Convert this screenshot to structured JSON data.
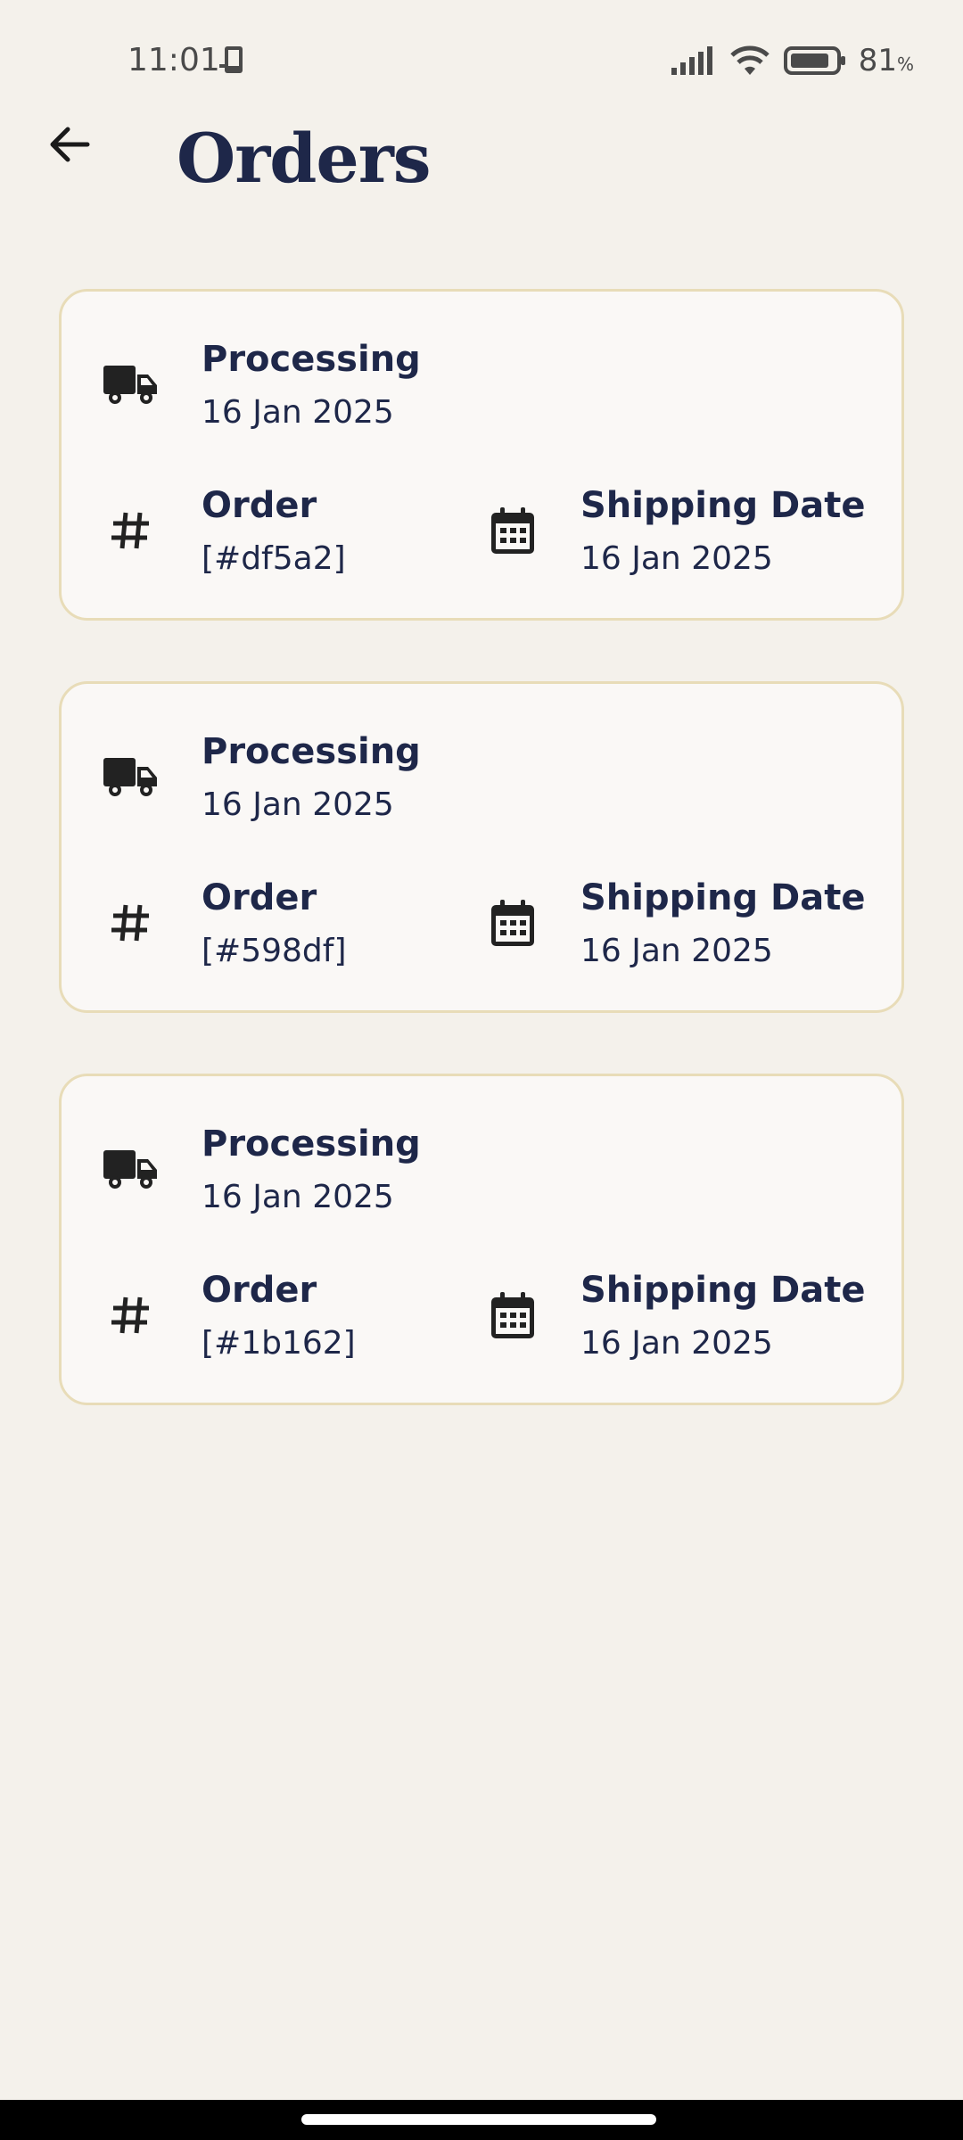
{
  "status_bar": {
    "time": "11:01",
    "battery_percent": "81",
    "battery_unit": "%",
    "icons": [
      "device-icon",
      "signal-icon",
      "wifi-icon",
      "battery-icon"
    ]
  },
  "header": {
    "title": "Orders",
    "back_icon": "arrow-left-icon"
  },
  "orders": [
    {
      "status": "Processing",
      "status_date": "16 Jan 2025",
      "order_label": "Order",
      "order_id": "[#df5a2]",
      "shipping_label": "Shipping Date",
      "shipping_date": "16 Jan 2025"
    },
    {
      "status": "Processing",
      "status_date": "16 Jan 2025",
      "order_label": "Order",
      "order_id": "[#598df]",
      "shipping_label": "Shipping Date",
      "shipping_date": "16 Jan 2025"
    },
    {
      "status": "Processing",
      "status_date": "16 Jan 2025",
      "order_label": "Order",
      "order_id": "[#1b162]",
      "shipping_label": "Shipping Date",
      "shipping_date": "16 Jan 2025"
    }
  ],
  "colors": {
    "background": "#f4f1eb",
    "card_background": "#faf8f6",
    "card_border": "#e8dcb8",
    "text_primary": "#1e2749",
    "icon": "#222222"
  }
}
